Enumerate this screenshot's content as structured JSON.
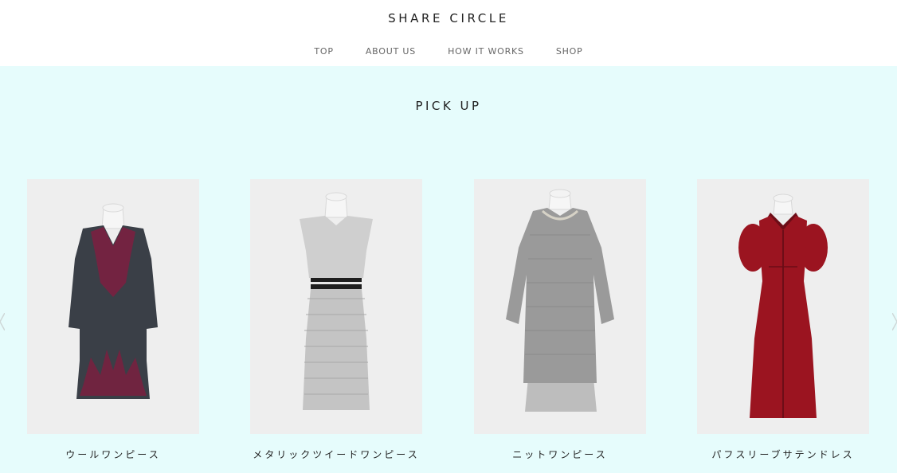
{
  "header": {
    "logo": "SHARE CIRCLE",
    "nav": [
      "TOP",
      "ABOUT US",
      "HOW IT WORKS",
      "SHOP"
    ]
  },
  "pickup": {
    "title": "PICK UP",
    "items": [
      {
        "name": "ウールワンピース",
        "image_icon": "wool-dress-image",
        "dress_color": "#3a3f47",
        "accent_color": "#7a2040"
      },
      {
        "name": "メタリックツイードワンピース",
        "image_icon": "tweed-dress-image",
        "dress_color": "#c9c9c9",
        "accent_color": "#222222"
      },
      {
        "name": "ニットワンピース",
        "image_icon": "knit-dress-image",
        "dress_color": "#9a9a9a",
        "accent_color": "#bdbdbd"
      },
      {
        "name": "パフスリーブサテンドレス",
        "image_icon": "satin-dress-image",
        "dress_color": "#9b1420",
        "accent_color": "#6d0d17"
      }
    ]
  },
  "colors": {
    "section_bg": "#e6fcfc",
    "card_bg": "#eeeeee"
  }
}
